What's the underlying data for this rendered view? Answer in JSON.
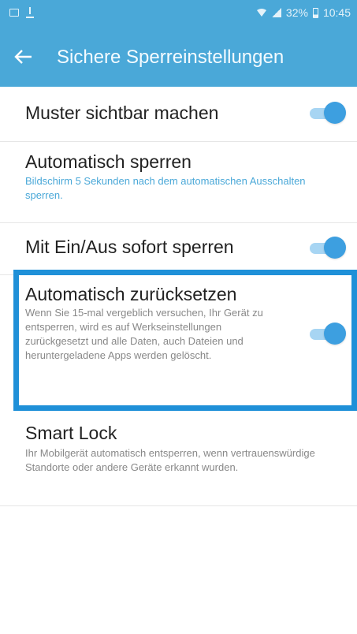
{
  "status_bar": {
    "notification_icons": [
      "screenshot-icon",
      "download-icon"
    ],
    "battery_text": "32%",
    "time": "10:45",
    "icons": [
      "wifi-icon",
      "signal-icon",
      "battery-icon"
    ]
  },
  "app_bar": {
    "back_icon": "arrow-left-icon",
    "title": "Sichere Sperreinstellungen",
    "background_color": "#4aa8d8"
  },
  "settings": [
    {
      "title": "Muster sichtbar machen",
      "summary": "",
      "toggle": true
    },
    {
      "title": "Automatisch sperren",
      "summary": "Bildschirm 5 Sekunden nach dem automatischen Ausschalten sperren.",
      "toggle": null
    },
    {
      "title": "Mit Ein/Aus sofort sperren",
      "summary": "",
      "toggle": true
    },
    {
      "title": "Automatisch zurücksetzen",
      "summary": "Wenn Sie 15-mal vergeblich versuchen, Ihr Gerät zu entsperren, wird es auf Werkseinstellungen zurückgesetzt und alle Daten, auch Dateien und heruntergeladene Apps werden gelöscht.",
      "toggle": true,
      "highlighted": true
    },
    {
      "title": "Smart Lock",
      "summary": "Ihr Mobilgerät automatisch entsperren, wenn vertrauenswürdige Standorte oder andere Geräte erkannt wurden.",
      "toggle": null
    }
  ],
  "colors": {
    "accent": "#3d9fe0",
    "highlight_border": "#1f90d8",
    "summary_text": "#888888",
    "link_summary": "#4aa8d8"
  }
}
